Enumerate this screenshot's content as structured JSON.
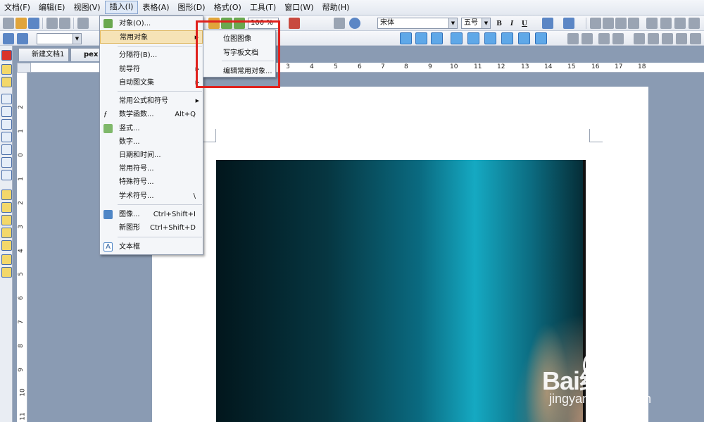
{
  "menubar": [
    {
      "label": "文档(F)",
      "active": false
    },
    {
      "label": "编辑(E)",
      "active": false
    },
    {
      "label": "视图(V)",
      "active": false
    },
    {
      "label": "插入(I)",
      "active": true
    },
    {
      "label": "表格(A)",
      "active": false
    },
    {
      "label": "图形(D)",
      "active": false
    },
    {
      "label": "格式(O)",
      "active": false
    },
    {
      "label": "工具(T)",
      "active": false
    },
    {
      "label": "窗口(W)",
      "active": false
    },
    {
      "label": "帮助(H)",
      "active": false
    }
  ],
  "toolbar": {
    "zoom": "100 %",
    "font_name": "宋体",
    "font_size": "五号",
    "bold": "B",
    "italic": "I",
    "underline": "U"
  },
  "tabs": [
    "新建文档1",
    "pex"
  ],
  "insert_menu": {
    "items": [
      {
        "label": "对象(O)...",
        "shortcut": "",
        "submenu": false,
        "icon": "object-icon"
      },
      {
        "label": "常用对象",
        "shortcut": "",
        "submenu": true,
        "icon": ""
      },
      {
        "label": "分隔符(B)...",
        "shortcut": "",
        "submenu": false,
        "icon": ""
      },
      {
        "label": "前导符",
        "shortcut": "",
        "submenu": true,
        "icon": ""
      },
      {
        "label": "自动图文集",
        "shortcut": "",
        "submenu": true,
        "icon": ""
      },
      {
        "label": "常用公式和符号",
        "shortcut": "",
        "submenu": true,
        "icon": ""
      },
      {
        "label": "数学函数...",
        "shortcut": "Alt+Q",
        "submenu": false,
        "icon": "function-icon"
      },
      {
        "label": "竖式...",
        "shortcut": "",
        "submenu": false,
        "icon": "vertical-calc-icon"
      },
      {
        "label": "数字...",
        "shortcut": "",
        "submenu": false,
        "icon": ""
      },
      {
        "label": "日期和时间...",
        "shortcut": "",
        "submenu": false,
        "icon": ""
      },
      {
        "label": "常用符号...",
        "shortcut": "",
        "submenu": false,
        "icon": ""
      },
      {
        "label": "特殊符号...",
        "shortcut": "",
        "submenu": false,
        "icon": ""
      },
      {
        "label": "学术符号...",
        "shortcut": "\\",
        "submenu": false,
        "icon": ""
      },
      {
        "label": "图像...",
        "shortcut": "Ctrl+Shift+I",
        "submenu": false,
        "icon": "image-icon"
      },
      {
        "label": "新图形",
        "shortcut": "Ctrl+Shift+D",
        "submenu": false,
        "icon": ""
      },
      {
        "label": "文本框",
        "shortcut": "",
        "submenu": false,
        "icon": "textbox-icon"
      }
    ]
  },
  "sub_menu": {
    "items": [
      "位图图像",
      "写字板文档",
      "编辑常用对象..."
    ]
  },
  "ruler": {
    "h_numbers": [
      "3",
      "4",
      "5",
      "6",
      "7",
      "8",
      "9",
      "10",
      "11",
      "12",
      "13",
      "14",
      "15",
      "16",
      "17",
      "18"
    ],
    "v_numbers": [
      "2",
      "1",
      "0",
      "1",
      "2",
      "3",
      "4",
      "5",
      "6",
      "7",
      "8",
      "9",
      "10",
      "11"
    ]
  },
  "watermark": {
    "brand": "Bai经验",
    "sub": "jingyan.baidu.com"
  },
  "colors": {
    "highlight": "#f6e3b6",
    "callout": "#e0221e",
    "workspace": "#8a9bb3"
  }
}
